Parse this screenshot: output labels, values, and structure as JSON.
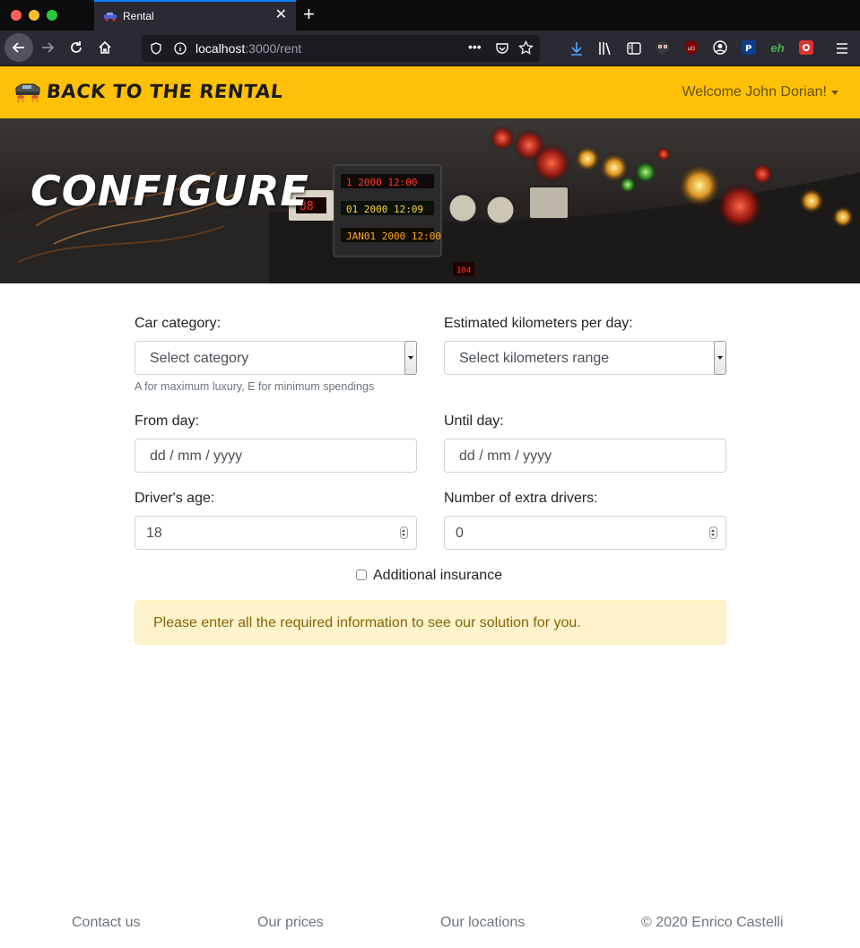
{
  "browser": {
    "tab_title": "Rental",
    "url_host": "localhost",
    "url_path": ":3000/rent",
    "new_tab_symbol": "+",
    "close_symbol": "✕",
    "accent_color": "#0a84ff"
  },
  "header": {
    "brand": "BACK TO THE RENTAL",
    "welcome": "Welcome John Dorian!",
    "background_color": "#ffc107"
  },
  "hero": {
    "title": "CONFIGURE"
  },
  "form": {
    "category_label": "Car category:",
    "category_value": "Select category",
    "category_help": "A for maximum luxury, E for minimum spendings",
    "km_label": "Estimated kilometers per day:",
    "km_value": "Select kilometers range",
    "from_label": "From day:",
    "from_value": "dd / mm / yyyy",
    "until_label": "Until day:",
    "until_value": "dd / mm / yyyy",
    "age_label": "Driver's age:",
    "age_value": "18",
    "drivers_label": "Number of extra drivers:",
    "drivers_value": "0",
    "insurance_label": "Additional insurance",
    "alert": "Please enter all the required information to see our solution for you."
  },
  "footer": {
    "contact": "Contact us",
    "prices": "Our prices",
    "locations": "Our locations",
    "copyright": "© 2020 Enrico Castelli"
  }
}
